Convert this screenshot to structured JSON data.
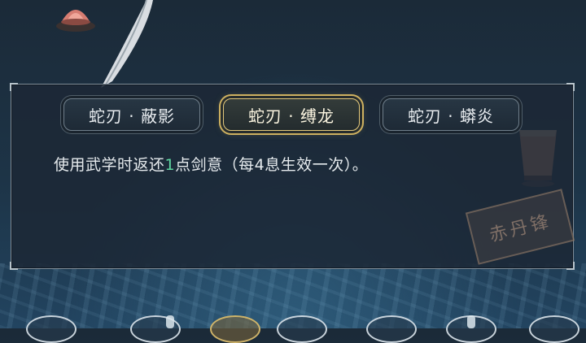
{
  "skill_panel": {
    "tabs": [
      {
        "label": "蛇刃 · 蔽影",
        "selected": false
      },
      {
        "label": "蛇刃 · 缚龙",
        "selected": true
      },
      {
        "label": "蛇刃 · 蟒炎",
        "selected": false
      }
    ],
    "description": {
      "before": "使用武学时返还",
      "value": "1",
      "after": "点剑意（每4息生效一次）。"
    },
    "stamp_text": "赤丹锋"
  },
  "colors": {
    "selected_tab_border": "#e2c77a",
    "highlight_number": "#5fd6a0"
  }
}
